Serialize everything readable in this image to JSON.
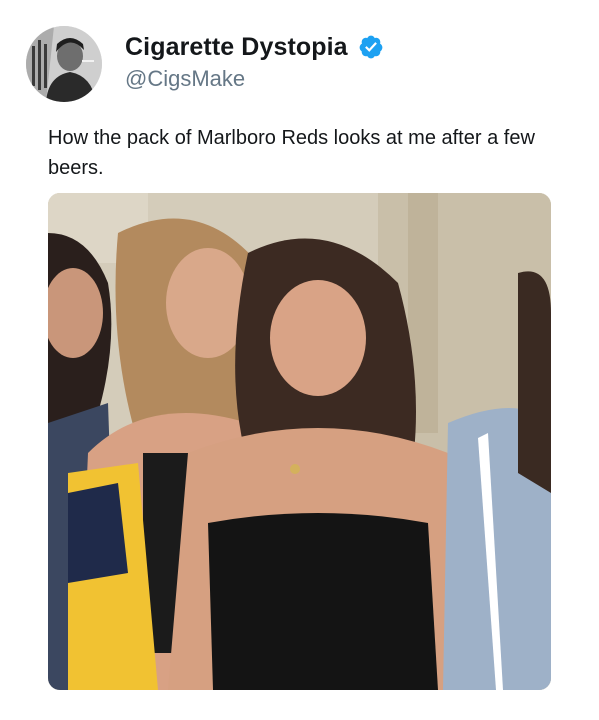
{
  "tweet": {
    "display_name": "Cigarette Dystopia",
    "handle": "@CigsMake",
    "verified_icon": "verified-badge-icon",
    "avatar_icon": "profile-avatar",
    "text": "How the pack of Marlboro Reds looks at me after a few beers.",
    "media_icon": "photo-four-women-posing"
  },
  "colors": {
    "text_primary": "#14171a",
    "text_secondary": "#657786",
    "verified_blue": "#1da1f2"
  }
}
